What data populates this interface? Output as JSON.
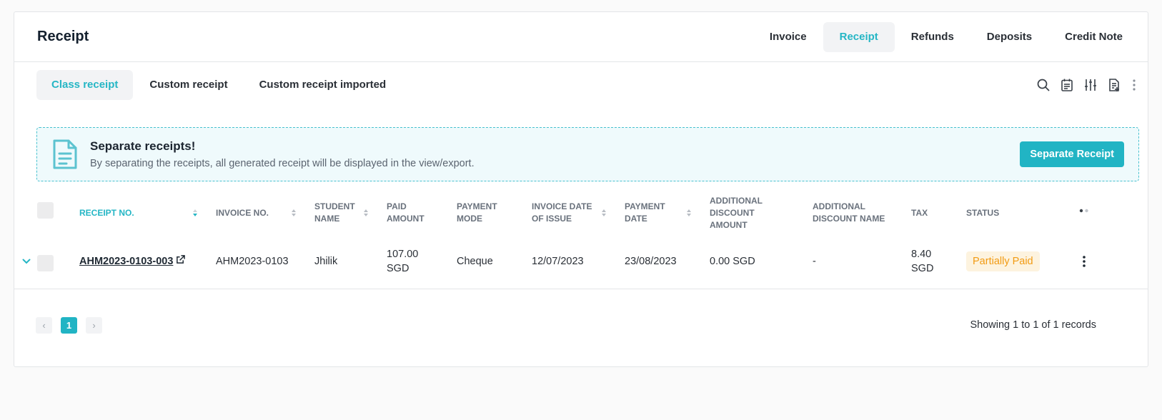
{
  "page": {
    "title": "Receipt"
  },
  "top_tabs": [
    {
      "label": "Invoice",
      "active": false
    },
    {
      "label": "Receipt",
      "active": true
    },
    {
      "label": "Refunds",
      "active": false
    },
    {
      "label": "Deposits",
      "active": false
    },
    {
      "label": "Credit Note",
      "active": false
    }
  ],
  "sub_tabs": [
    {
      "label": "Class receipt",
      "active": true
    },
    {
      "label": "Custom receipt",
      "active": false
    },
    {
      "label": "Custom receipt imported",
      "active": false
    }
  ],
  "toolbar_icons": [
    "search-icon",
    "calendar-icon",
    "filter-sliders-icon",
    "export-document-icon",
    "more-vertical-icon"
  ],
  "banner": {
    "icon": "document-icon",
    "title": "Separate receipts!",
    "description": "By separating the receipts, all generated receipt will be displayed in the view/export.",
    "button_label": "Separate Receipt"
  },
  "table": {
    "columns": [
      {
        "key": "receipt_no",
        "label": "RECEIPT NO."
      },
      {
        "key": "invoice_no",
        "label": "INVOICE NO."
      },
      {
        "key": "student_name",
        "label": "STUDENT NAME"
      },
      {
        "key": "paid_amount",
        "label": "PAID AMOUNT"
      },
      {
        "key": "payment_mode",
        "label": "PAYMENT MODE"
      },
      {
        "key": "invoice_date",
        "label": "INVOICE DATE OF ISSUE"
      },
      {
        "key": "payment_date",
        "label": "PAYMENT DATE"
      },
      {
        "key": "additional_discount_amount",
        "label": "ADDITIONAL DISCOUNT AMOUNT"
      },
      {
        "key": "additional_discount_name",
        "label": "ADDITIONAL DISCOUNT NAME"
      },
      {
        "key": "tax",
        "label": "TAX"
      },
      {
        "key": "status",
        "label": "STATUS"
      }
    ],
    "rows": [
      {
        "receipt_no": "AHM2023-0103-003",
        "invoice_no": "AHM2023-0103",
        "student_name": "Jhilik",
        "paid_amount": "107.00 SGD",
        "payment_mode": "Cheque",
        "invoice_date": "12/07/2023",
        "payment_date": "23/08/2023",
        "additional_discount_amount": "0.00 SGD",
        "additional_discount_name": "-",
        "tax": "8.40 SGD",
        "status": "Partially Paid"
      }
    ]
  },
  "pagination": {
    "prev": "‹",
    "current": "1",
    "next": "›",
    "summary": "Showing 1 to 1 of 1 records"
  },
  "colors": {
    "accent": "#21b4c4",
    "status_partial_text": "#f29b13",
    "status_partial_bg": "#fdf3df",
    "banner_bg": "#effafc"
  }
}
